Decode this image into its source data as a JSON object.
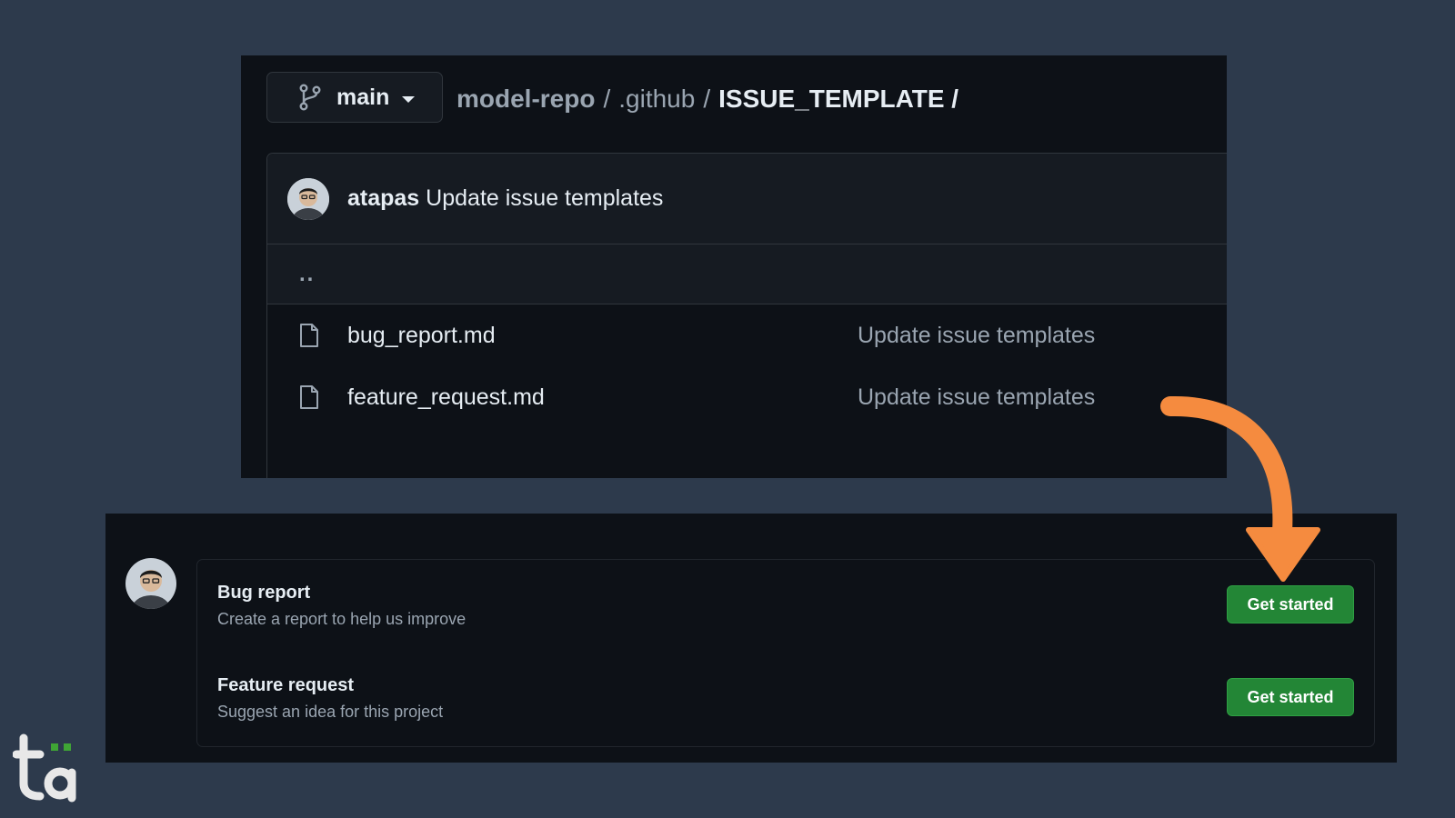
{
  "repo_browser": {
    "branch": "main",
    "breadcrumb": {
      "repo": "model-repo",
      "separator": "/",
      "folder": ".github",
      "current": "ISSUE_TEMPLATE /"
    },
    "latest_commit": {
      "author": "atapas",
      "message": "Update issue templates"
    },
    "parent_dir": "..",
    "files": [
      {
        "name": "bug_report.md",
        "commit_message": "Update issue templates",
        "icon": "file-icon"
      },
      {
        "name": "feature_request.md",
        "commit_message": "Update issue templates",
        "icon": "file-icon"
      }
    ]
  },
  "issue_templates": {
    "templates": [
      {
        "title": "Bug report",
        "description": "Create a report to help us improve",
        "button_label": "Get started"
      },
      {
        "title": "Feature request",
        "description": "Suggest an idea for this project",
        "button_label": "Get started"
      }
    ]
  },
  "colors": {
    "background": "#2d3a4c",
    "panel": "#0d1117",
    "button_green": "#238636",
    "arrow_orange": "#f58b3f",
    "logo_green": "#3fa535"
  },
  "logo": {
    "text": "ta"
  }
}
